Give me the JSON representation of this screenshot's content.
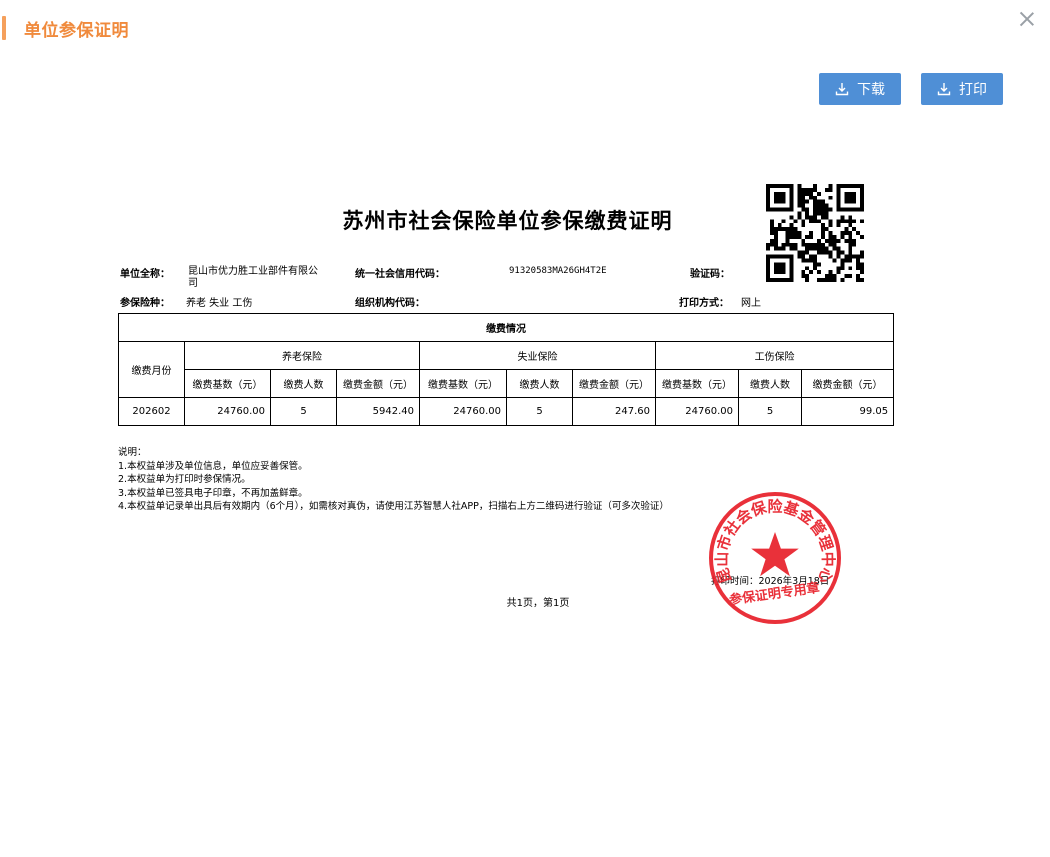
{
  "dialog": {
    "title": "单位参保证明",
    "download_label": "下载",
    "print_label": "打印"
  },
  "document": {
    "title": "苏州市社会保险单位参保缴费证明",
    "info": {
      "unit_name_label": "单位全称：",
      "unit_name_line1": "昆山市优力胜工业部件有限公",
      "unit_name_line2": "司",
      "credit_code_label": "统一社会信用代码：",
      "credit_code": "91320583MA26GH4T2E",
      "verify_label": "验证码：",
      "insurance_types_label": "参保险种：",
      "insurance_types": "养老 失业 工伤",
      "org_code_label": "组织机构代码：",
      "print_method_label": "打印方式：",
      "print_method": "网上"
    },
    "table": {
      "section_title": "缴费情况",
      "month_header": "缴费月份",
      "groups": [
        "养老保险",
        "失业保险",
        "工伤保险"
      ],
      "sub_headers": [
        "缴费基数（元）",
        "缴费人数",
        "缴费金额（元）"
      ],
      "rows": [
        {
          "month": "202602",
          "pension": [
            "24760.00",
            "5",
            "5942.40"
          ],
          "unemployment": [
            "24760.00",
            "5",
            "247.60"
          ],
          "injury": [
            "24760.00",
            "5",
            "99.05"
          ]
        }
      ]
    },
    "notes": [
      "说明：",
      "1.本权益单涉及单位信息，单位应妥善保管。",
      "2.本权益单为打印时参保情况。",
      "3.本权益单已签具电子印章，不再加盖鲜章。",
      "4.本权益单记录单出具后有效期内（6个月），如需核对真伪，请使用江苏智慧人社APP，扫描右上方二维码进行验证（可多次验证）"
    ],
    "print_time": "打印时间：2026年3月18日",
    "pager": "共1页，第1页",
    "stamp": {
      "ring_text": "昆山市社会保险基金管理中心",
      "bottom_text": "参保证明专用章",
      "color": "#e8202a"
    }
  }
}
